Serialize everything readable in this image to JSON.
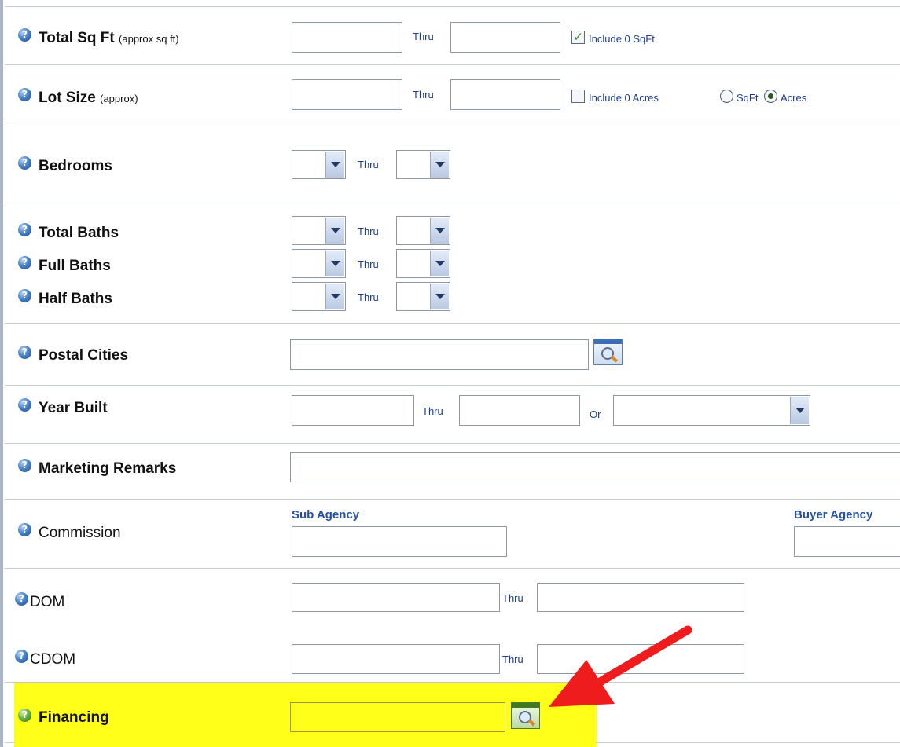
{
  "rows": {
    "total_sqft": {
      "label": "Total Sq Ft",
      "sub": "(approx sq ft)",
      "thru": "Thru",
      "checkbox_label": "Include 0 SqFt",
      "checkbox_checked": true
    },
    "lot_size": {
      "label": "Lot Size",
      "sub": "(approx)",
      "thru": "Thru",
      "checkbox_label": "Include 0 Acres",
      "checkbox_checked": false,
      "radio_sqft": "SqFt",
      "radio_acres": "Acres",
      "selected_unit": "Acres"
    },
    "bedrooms": {
      "label": "Bedrooms",
      "thru": "Thru"
    },
    "total_baths": {
      "label": "Total Baths",
      "thru": "Thru"
    },
    "full_baths": {
      "label": "Full Baths",
      "thru": "Thru"
    },
    "half_baths": {
      "label": "Half Baths",
      "thru": "Thru"
    },
    "postal_cities": {
      "label": "Postal Cities"
    },
    "year_built": {
      "label": "Year Built",
      "thru": "Thru",
      "or": "Or"
    },
    "marketing_remarks": {
      "label": "Marketing Remarks"
    },
    "commission": {
      "label": "Commission",
      "sub_agency": "Sub Agency",
      "buyer_agency": "Buyer Agency"
    },
    "dom": {
      "label": "DOM",
      "thru": "Thru"
    },
    "cdom": {
      "label": "CDOM",
      "thru": "Thru"
    },
    "financing": {
      "label": "Financing"
    }
  },
  "icons": {
    "help": "help-icon",
    "lookup": "magnifier-lookup-icon"
  },
  "colors": {
    "highlight": "#ffff1a",
    "arrow": "#ee1c1c",
    "label_blue": "#2451a6"
  },
  "help_glyph": "?"
}
